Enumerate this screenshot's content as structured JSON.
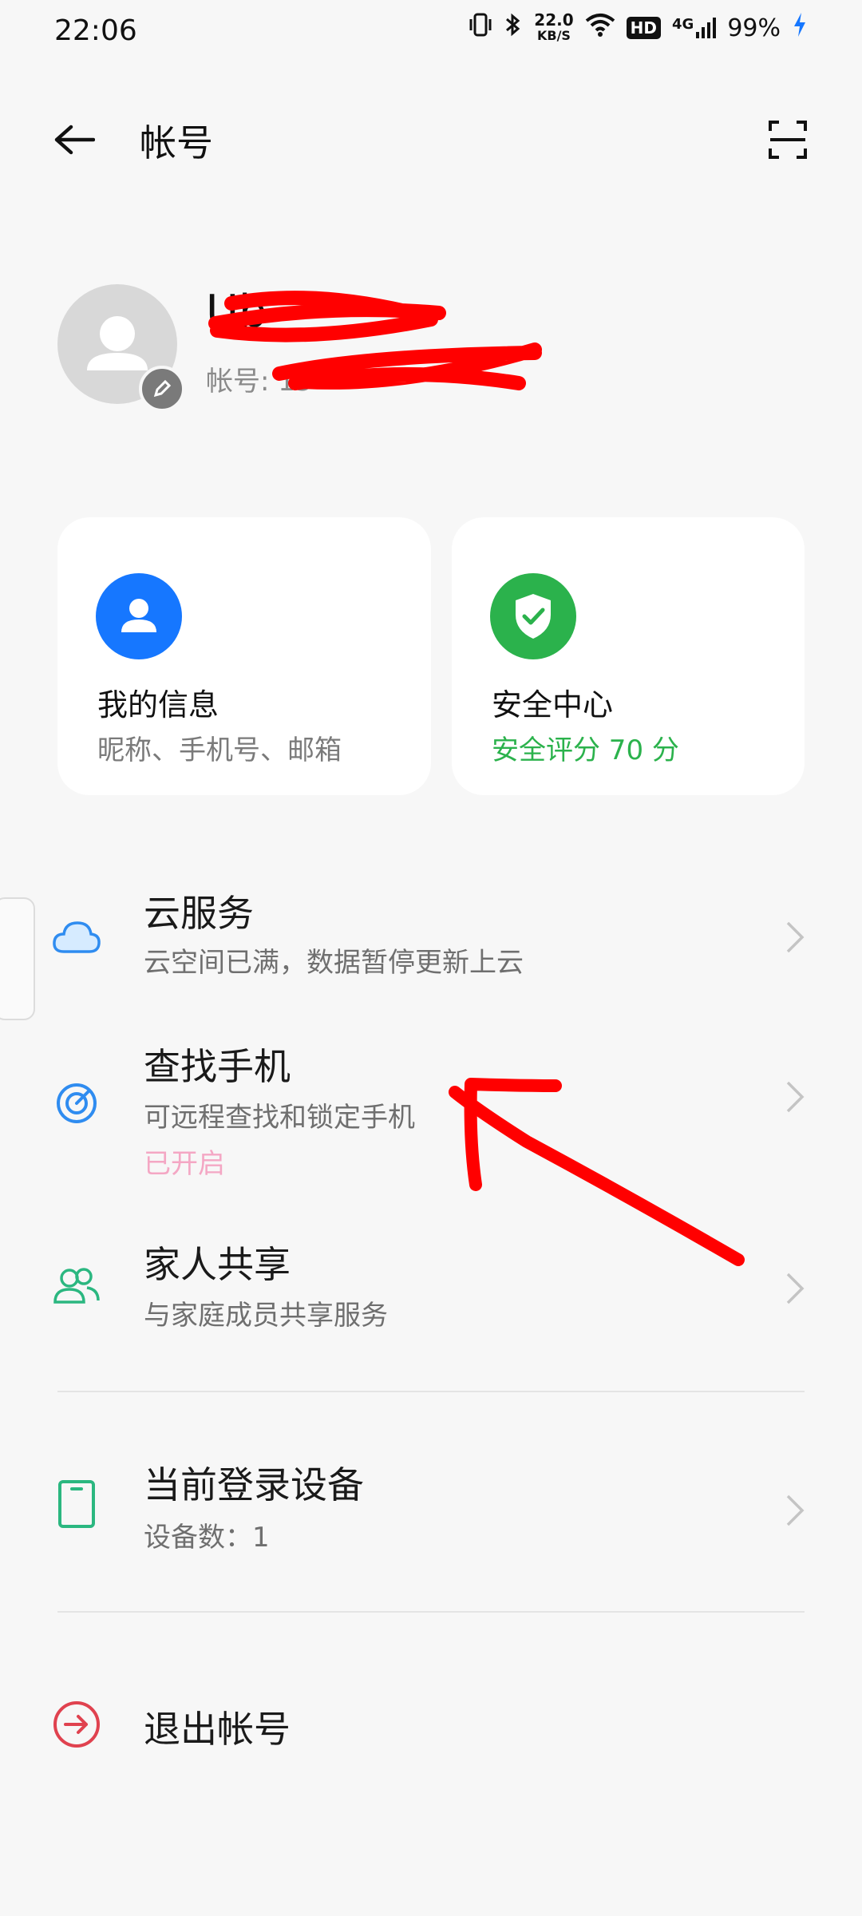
{
  "status_bar": {
    "time": "22:06",
    "speed_value": "22.0",
    "speed_unit": "KB/S",
    "hd": "HD",
    "net": "4G",
    "battery": "99%"
  },
  "header": {
    "title": "帐号"
  },
  "profile": {
    "name": "Ub",
    "account_prefix": "帐号: 15"
  },
  "cards": {
    "info": {
      "title": "我的信息",
      "subtitle": "昵称、手机号、邮箱"
    },
    "security": {
      "title": "安全中心",
      "subtitle": "安全评分 70 分"
    }
  },
  "menu": {
    "cloud": {
      "title": "云服务",
      "subtitle": "云空间已满，数据暂停更新上云"
    },
    "find_phone": {
      "title": "查找手机",
      "subtitle": "可远程查找和锁定手机",
      "status": "已开启"
    },
    "family": {
      "title": "家人共享",
      "subtitle": "与家庭成员共享服务"
    },
    "devices": {
      "title": "当前登录设备",
      "subtitle": "设备数：1"
    },
    "logout": {
      "title": "退出帐号"
    }
  },
  "colors": {
    "info_icon_bg": "#1677ff",
    "security_icon_bg": "#2bb24c",
    "security_score_text": "#2bb24c",
    "enabled_text": "#f4a7c4",
    "logout_icon": "#e0424f",
    "annotation_red": "#ff0000"
  }
}
